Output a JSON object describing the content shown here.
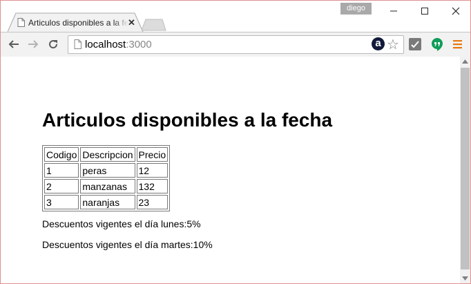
{
  "browser": {
    "profile_name": "diego",
    "tab": {
      "title": "Articulos disponibles a la fecha",
      "close_label": "✕"
    },
    "url_host": "localhost",
    "url_port": ":3000"
  },
  "page": {
    "heading": "Articulos disponibles a la fecha",
    "table": {
      "headers": [
        "Codigo",
        "Descripcion",
        "Precio"
      ],
      "rows": [
        [
          "1",
          "peras",
          "12"
        ],
        [
          "2",
          "manzanas",
          "132"
        ],
        [
          "3",
          "naranjas",
          "23"
        ]
      ]
    },
    "discounts": [
      "Descuentos vigentes el día lunes:5%",
      "Descuentos vigentes el día martes:10%"
    ]
  },
  "icons": {
    "amazon_glyph": "a"
  },
  "colors": {
    "window_border": "#e08f8f",
    "hangouts_green": "#0f9d58",
    "menu_orange": "#e8760a"
  }
}
